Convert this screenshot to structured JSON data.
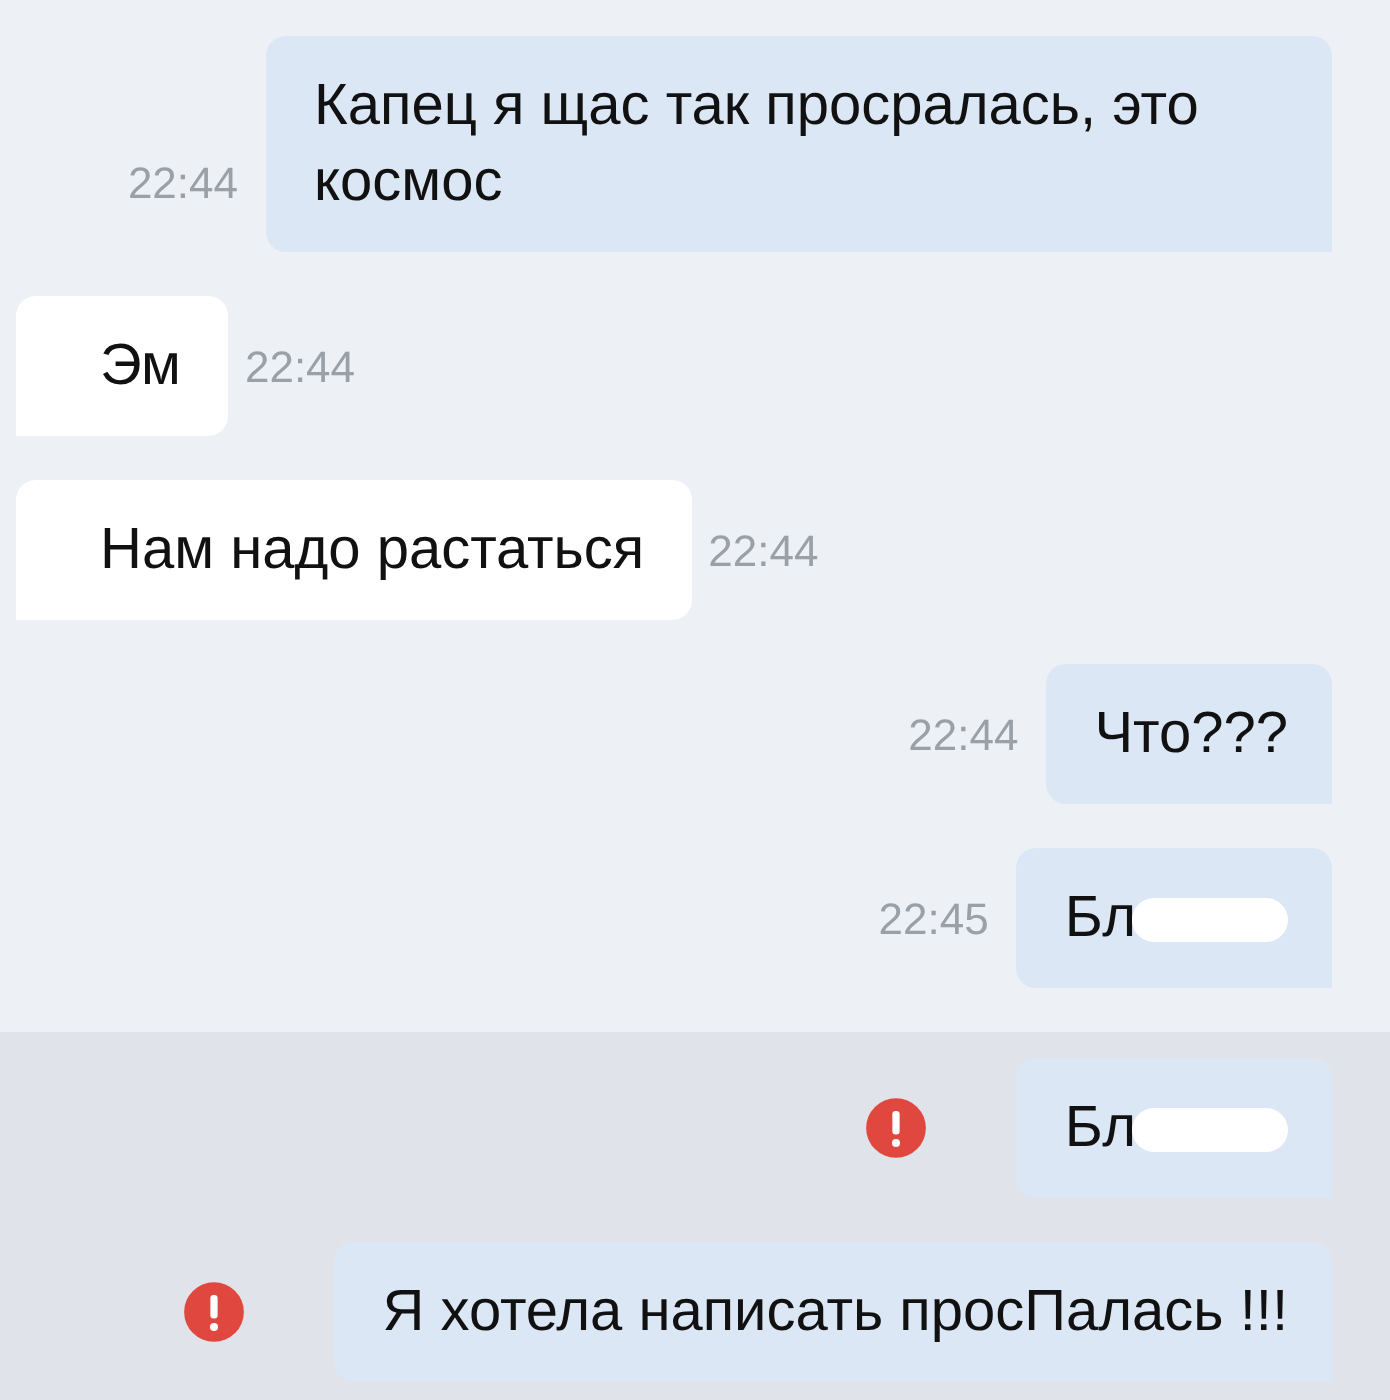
{
  "messages": [
    {
      "kind": "outgoing",
      "text": "Капец я щас так просралась, это космос",
      "time": "22:44",
      "failed": false,
      "redacted": false
    },
    {
      "kind": "incoming",
      "text": "Эм",
      "time": "22:44",
      "failed": false,
      "redacted": false
    },
    {
      "kind": "incoming",
      "text": "Нам надо растаться",
      "time": "22:44",
      "failed": false,
      "redacted": false
    },
    {
      "kind": "outgoing",
      "text": "Что???",
      "time": "22:44",
      "failed": false,
      "redacted": false
    },
    {
      "kind": "outgoing",
      "text": "Бл",
      "time": "22:45",
      "failed": false,
      "redacted": true
    },
    {
      "kind": "outgoing",
      "text": "Бл",
      "failed": true,
      "redacted": true
    },
    {
      "kind": "outgoing",
      "text": "Я хотела написать просПалась !!!",
      "failed": true,
      "redacted": false
    }
  ]
}
